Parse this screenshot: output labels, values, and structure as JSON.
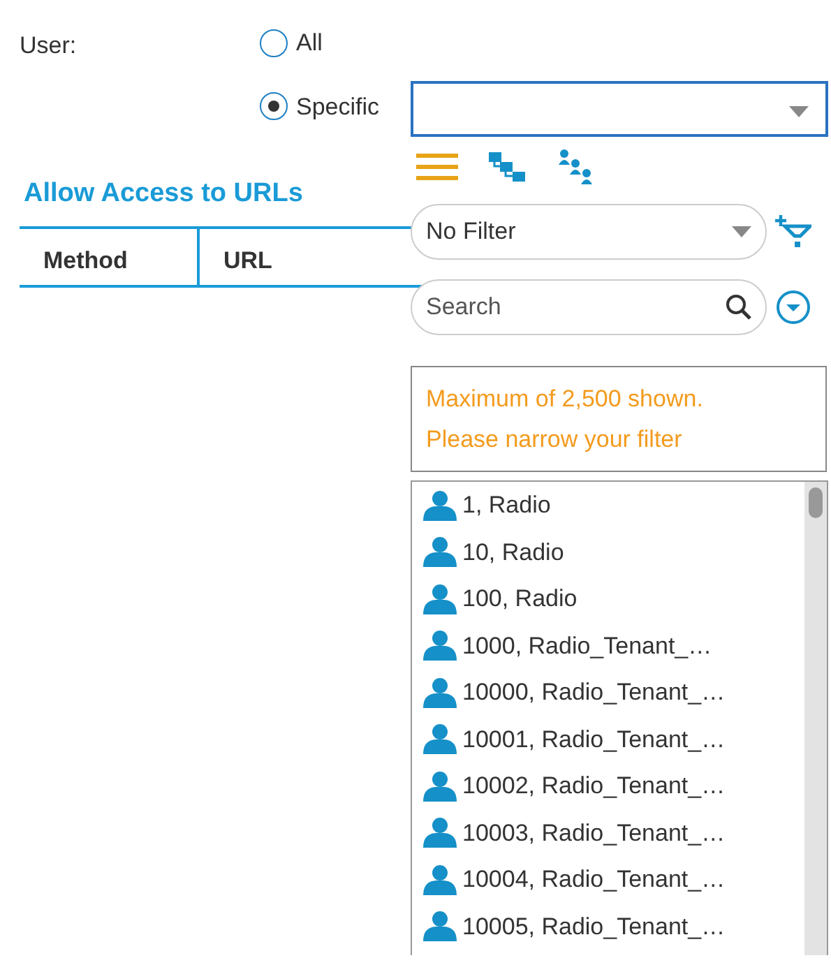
{
  "user_field": {
    "label": "User:",
    "options": [
      {
        "label": "All",
        "selected": false
      },
      {
        "label": "Specific",
        "selected": true
      }
    ]
  },
  "section": {
    "title": "Allow Access to URLs",
    "columns": [
      "Method",
      "URL"
    ]
  },
  "dropdown": {
    "view_modes": [
      {
        "kind": "list",
        "selected": true
      },
      {
        "kind": "tree",
        "selected": false
      },
      {
        "kind": "group",
        "selected": false
      }
    ],
    "filter": {
      "value": "No Filter"
    },
    "search": {
      "placeholder": "Search"
    },
    "message": "Maximum of 2,500 shown. Please narrow your filter",
    "users": [
      {
        "label": "1, Radio"
      },
      {
        "label": "10, Radio"
      },
      {
        "label": "100, Radio"
      },
      {
        "label": "1000, Radio_Tenant_…"
      },
      {
        "label": "10000, Radio_Tenant_…"
      },
      {
        "label": "10001, Radio_Tenant_…"
      },
      {
        "label": "10002, Radio_Tenant_…"
      },
      {
        "label": "10003, Radio_Tenant_…"
      },
      {
        "label": "10004, Radio_Tenant_…"
      },
      {
        "label": "10005, Radio_Tenant_…"
      }
    ]
  }
}
